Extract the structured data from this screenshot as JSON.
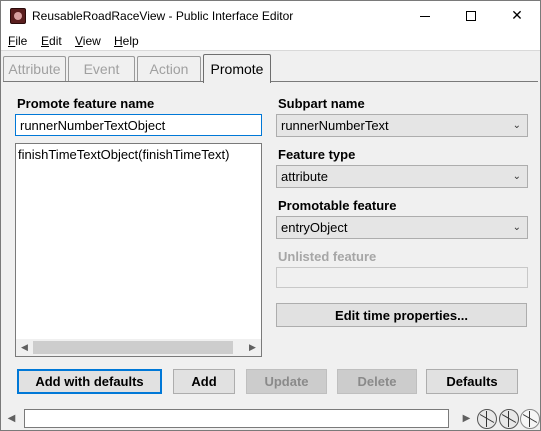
{
  "window": {
    "title": "ReusableRoadRaceView - Public Interface Editor",
    "controls": {
      "minimize": "minimize",
      "maximize": "maximize",
      "close": "✕"
    }
  },
  "menu": [
    {
      "first": "F",
      "rest": "ile"
    },
    {
      "first": "E",
      "rest": "dit"
    },
    {
      "first": "V",
      "rest": "iew"
    },
    {
      "first": "H",
      "rest": "elp"
    }
  ],
  "tabs": [
    "Attribute",
    "Event",
    "Action",
    "Promote"
  ],
  "active_tab": "Promote",
  "left": {
    "label": "Promote feature name",
    "name_value": "runnerNumberTextObject",
    "list_items": [
      "finishTimeTextObject(finishTimeText)"
    ]
  },
  "right": {
    "subpart_label": "Subpart name",
    "subpart_value": "runnerNumberText",
    "feature_type_label": "Feature type",
    "feature_type_value": "attribute",
    "promotable_label": "Promotable feature",
    "promotable_value": "entryObject",
    "unlisted_label": "Unlisted feature",
    "unlisted_value": "",
    "edit_time_button": "Edit time properties..."
  },
  "buttons": {
    "add_with_defaults": "Add with defaults",
    "add": "Add",
    "update": "Update",
    "delete": "Delete",
    "defaults": "Defaults"
  },
  "icons": {
    "app": "app-icon",
    "chevron": "chevron-down-icon",
    "scroll_left": "◀",
    "scroll_right": "▶",
    "wheel": "wheel-icon"
  }
}
